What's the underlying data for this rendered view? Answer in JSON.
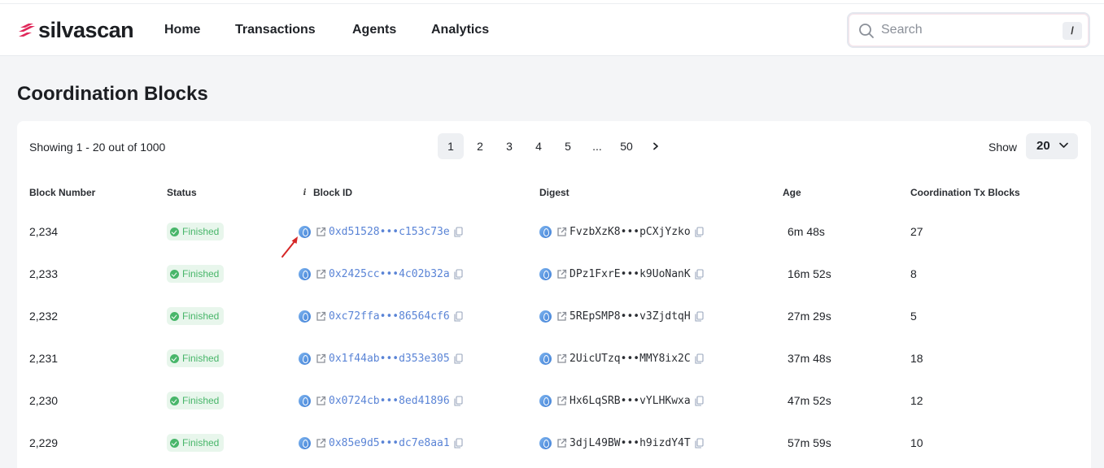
{
  "brand": {
    "name": "silvascan"
  },
  "nav": [
    {
      "label": "Home"
    },
    {
      "label": "Transactions"
    },
    {
      "label": "Agents"
    },
    {
      "label": "Analytics"
    }
  ],
  "search": {
    "placeholder": "Search",
    "shortcut": "/"
  },
  "page": {
    "title": "Coordination Blocks"
  },
  "toolbar": {
    "showing": "Showing 1 - 20 out of 1000",
    "pages": [
      "1",
      "2",
      "3",
      "4",
      "5",
      "...",
      "50"
    ],
    "active_page": "1",
    "show_label": "Show",
    "page_size": "20"
  },
  "table": {
    "columns": [
      "Block Number",
      "Status",
      "Block ID",
      "Digest",
      "Age",
      "Coordination Tx Blocks"
    ],
    "rows": [
      {
        "block": "2,234",
        "status": "Finished",
        "block_id": "0xd51528•••c153c73e",
        "digest": "FvzbXzK8•••pCXjYzko",
        "age": "6m 48s",
        "tx_blocks": "27"
      },
      {
        "block": "2,233",
        "status": "Finished",
        "block_id": "0x2425cc•••4c02b32a",
        "digest": "DPz1FxrE•••k9UoNanK",
        "age": "16m 52s",
        "tx_blocks": "8"
      },
      {
        "block": "2,232",
        "status": "Finished",
        "block_id": "0xc72ffa•••86564cf6",
        "digest": "5REpSMP8•••v3ZjdtqH",
        "age": "27m 29s",
        "tx_blocks": "5"
      },
      {
        "block": "2,231",
        "status": "Finished",
        "block_id": "0x1f44ab•••d353e305",
        "digest": "2UicUTzq•••MMY8ix2C",
        "age": "37m 48s",
        "tx_blocks": "18"
      },
      {
        "block": "2,230",
        "status": "Finished",
        "block_id": "0x0724cb•••8ed41896",
        "digest": "Hx6LqSRB•••vYLHKwxa",
        "age": "47m 52s",
        "tx_blocks": "12"
      },
      {
        "block": "2,229",
        "status": "Finished",
        "block_id": "0x85e9d5•••dc7e8aa1",
        "digest": "3djL49BW•••h9izdY4T",
        "age": "57m 59s",
        "tx_blocks": "10"
      }
    ]
  },
  "colors": {
    "accent": "#e0285a",
    "link": "#5a84d6",
    "success": "#48b66a",
    "success_bg": "#e8f6ec"
  },
  "icons": [
    "search-icon",
    "chevron-right-icon",
    "chevron-down-icon",
    "info-icon",
    "chain-icon",
    "external-link-icon",
    "copy-icon",
    "annotation-arrow-icon"
  ]
}
